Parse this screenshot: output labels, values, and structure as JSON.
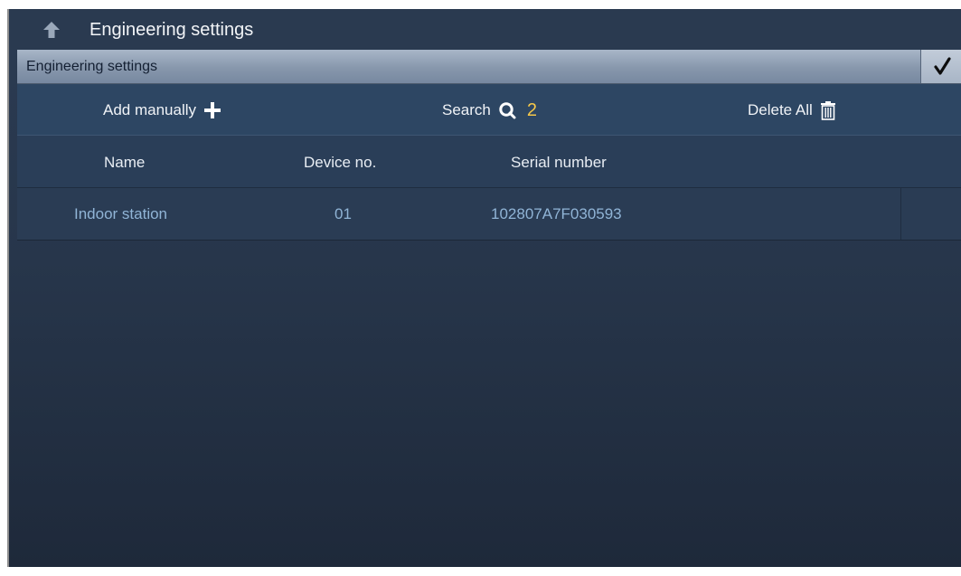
{
  "header": {
    "title": "Engineering settings"
  },
  "section": {
    "title": "Engineering settings"
  },
  "toolbar": {
    "add_label": "Add manually",
    "search_label": "Search",
    "search_count": "2",
    "delete_label": "Delete All"
  },
  "table": {
    "columns": [
      "Name",
      "Device no.",
      "Serial number"
    ],
    "rows": [
      {
        "name": "Indoor station",
        "device_no": "01",
        "serial": "102807A7F030593"
      }
    ]
  },
  "icons": {
    "back": "arrow-up-back-icon",
    "confirm": "checkmark-icon",
    "add": "plus-icon",
    "search": "search-icon",
    "delete": "trash-icon"
  },
  "colors": {
    "accent_count": "#f5c84a",
    "row_text": "#90b4d6",
    "background": "#27364b"
  }
}
